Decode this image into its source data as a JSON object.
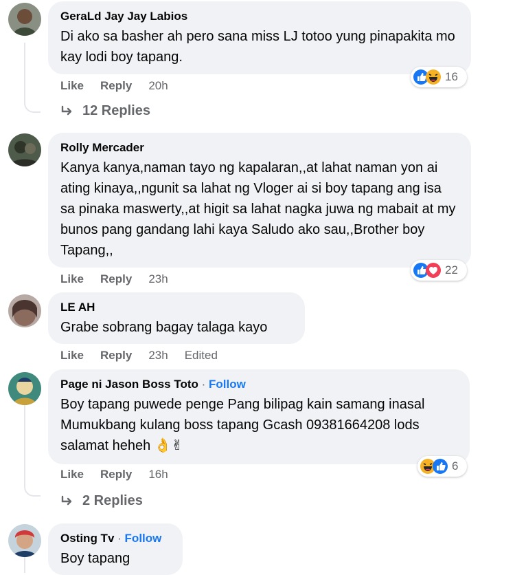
{
  "comments": [
    {
      "author": "GeraLd Jay Jay Labios",
      "text": "Di ako sa basher ah pero sana miss LJ totoo yung pinapakita mo kay lodi boy tapang.",
      "actions": {
        "like": "Like",
        "reply": "Reply",
        "time": "20h"
      },
      "reaction_count": "16",
      "reactions": [
        "like-icon",
        "haha-icon"
      ],
      "replies": "12 Replies"
    },
    {
      "author": "Rolly Mercader",
      "text": "Kanya kanya,naman tayo ng kapalaran,,at lahat naman yon ai ating kinaya,,ngunit sa lahat ng Vloger ai si boy tapang ang isa sa pinaka maswerty,,at higit sa lahat nagka juwa ng mabait at my bunos pang gandang lahi kaya Saludo ako sau,,Brother boy Tapang,,",
      "actions": {
        "like": "Like",
        "reply": "Reply",
        "time": "23h"
      },
      "reaction_count": "22",
      "reactions": [
        "like-icon",
        "heart-icon"
      ]
    },
    {
      "author": "LE AH",
      "text": "Grabe sobrang bagay talaga kayo",
      "actions": {
        "like": "Like",
        "reply": "Reply",
        "time": "23h",
        "edited": "Edited"
      }
    },
    {
      "author": "Page ni Jason Boss Toto",
      "separator": "·",
      "follow": "Follow",
      "text": "Boy tapang puwede penge Pang bilipag kain samang inasal Mumukbang kulang boss tapang Gcash 09381664208 lods salamat heheh 👌✌",
      "actions": {
        "like": "Like",
        "reply": "Reply",
        "time": "16h"
      },
      "reaction_count": "6",
      "reactions": [
        "haha-icon",
        "like-icon"
      ],
      "replies": "2 Replies"
    },
    {
      "author": "Osting Tv",
      "separator": "·",
      "follow": "Follow",
      "text": "Boy tapang"
    }
  ],
  "colors": {
    "bubble": "#f0f2f5",
    "secondary_text": "#65676b",
    "follow": "#1877f2",
    "like": "#1877f2",
    "heart": "#f33e58",
    "haha": "#f7b125"
  }
}
